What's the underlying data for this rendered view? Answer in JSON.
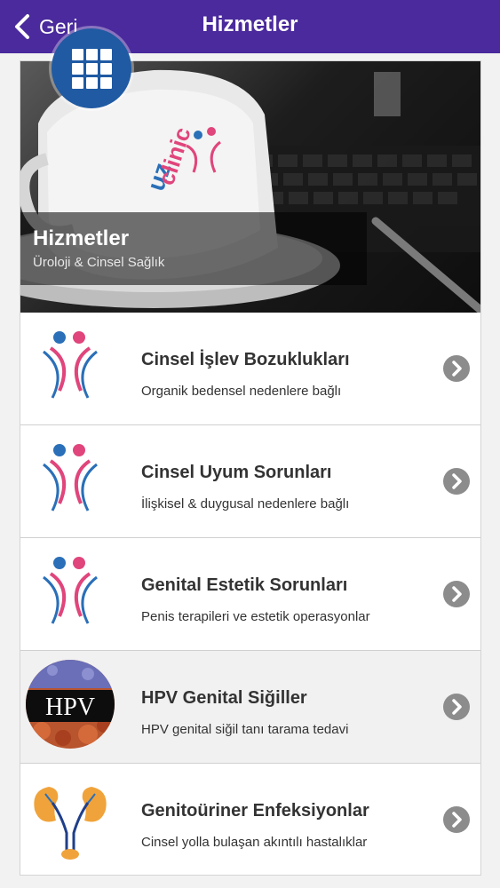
{
  "header": {
    "back_label": "Geri",
    "title": "Hizmetler"
  },
  "hero": {
    "title": "Hizmetler",
    "subtitle": "Üroloji & Cinsel Sağlık",
    "logo_text": "uzclinic"
  },
  "services": [
    {
      "title": "Cinsel İşlev Bozuklukları",
      "subtitle": "Organik bedensel nedenlere bağlı",
      "icon": "couple-logo-icon"
    },
    {
      "title": "Cinsel Uyum Sorunları",
      "subtitle": "İlişkisel & duygusal nedenlere bağlı",
      "icon": "couple-logo-icon"
    },
    {
      "title": "Genital Estetik Sorunları",
      "subtitle": "Penis terapileri ve estetik operasyonlar",
      "icon": "couple-logo-icon"
    },
    {
      "title": "HPV Genital Siğiller",
      "subtitle": "HPV genital siğil tanı tarama tedavi",
      "icon": "hpv-icon",
      "icon_text": "HPV"
    },
    {
      "title": "Genitoüriner Enfeksiyonlar",
      "subtitle": "Cinsel yolla bulaşan akıntılı hastalıklar",
      "icon": "kidney-icon"
    }
  ],
  "colors": {
    "header_bg": "#4a2a9c",
    "menu_button": "#1f5aa3",
    "logo_pink": "#e0457b",
    "logo_blue": "#2a6fb8"
  }
}
